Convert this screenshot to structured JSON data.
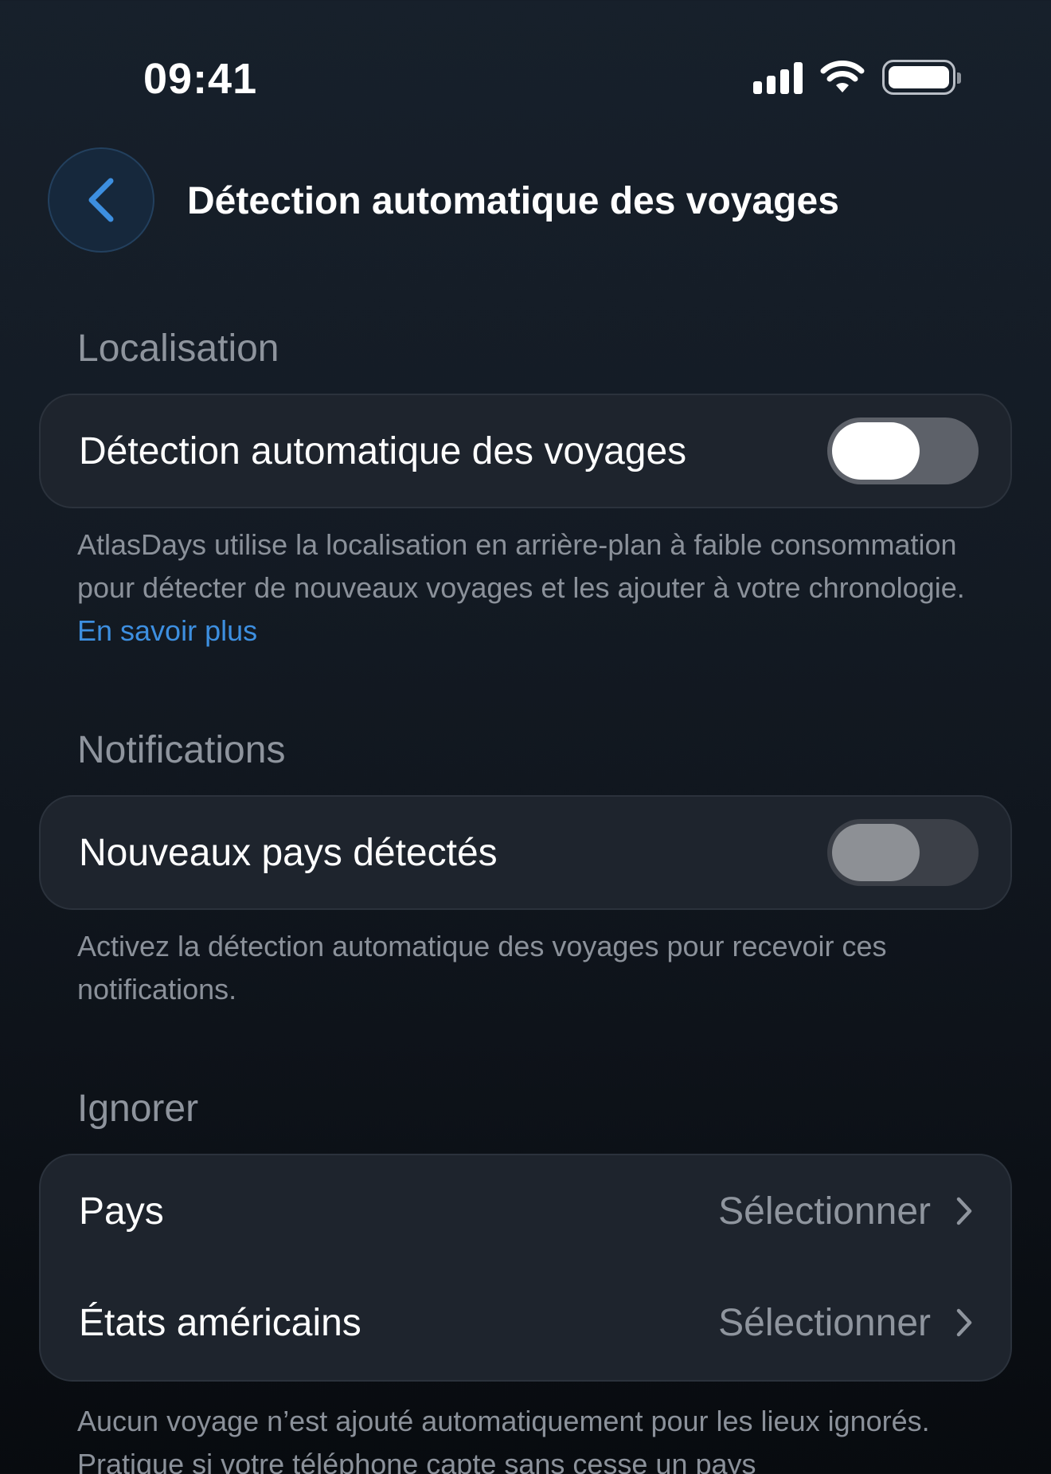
{
  "status_bar": {
    "time": "09:41",
    "icons": [
      "signal-icon",
      "wifi-icon",
      "battery-icon"
    ]
  },
  "nav": {
    "back_icon": "chevron-left-icon",
    "title": "Détection automatique des voyages"
  },
  "sections": {
    "location": {
      "header": "Localisation",
      "toggle_label": "Détection automatique des voyages",
      "toggle_on": false,
      "footnote": "AtlasDays utilise la localisation en arrière-plan à faible consommation pour détecter de nouveaux voyages et les ajouter à votre chronologie.",
      "link": "En savoir plus"
    },
    "notifications": {
      "header": "Notifications",
      "toggle_label": "Nouveaux pays détectés",
      "toggle_on": false,
      "toggle_disabled": true,
      "footnote": "Activez la détection automatique des voyages pour recevoir ces notifications."
    },
    "ignore": {
      "header": "Ignorer",
      "rows": [
        {
          "label": "Pays",
          "value": "Sélectionner"
        },
        {
          "label": "États américains",
          "value": "Sélectionner"
        }
      ],
      "footnote": "Aucun voyage n’est ajouté automatiquement pour les lieux ignorés. Pratique si votre téléphone capte sans cesse un pays"
    }
  },
  "colors": {
    "accent": "#3d8fe0",
    "card_bg": "#1e242d",
    "secondary_text": "#8e949d"
  }
}
